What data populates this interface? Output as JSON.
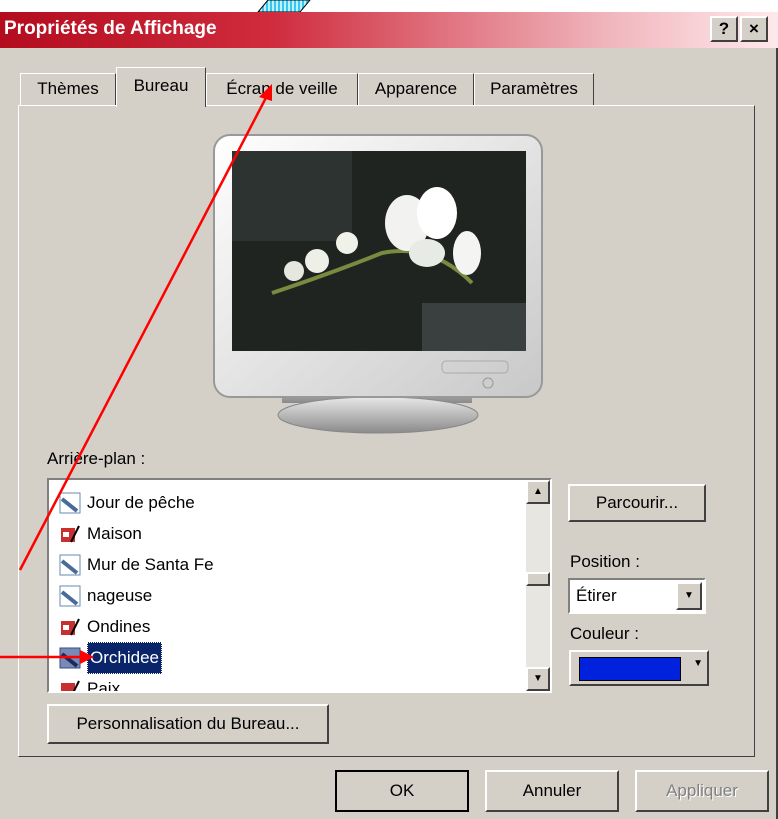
{
  "window": {
    "title": "Propriétés de Affichage",
    "help_label": "?",
    "close_label": "×"
  },
  "tabs": [
    {
      "label": "Thèmes"
    },
    {
      "label": "Bureau",
      "active": true
    },
    {
      "label": "Écran de veille"
    },
    {
      "label": "Apparence"
    },
    {
      "label": "Paramètres"
    }
  ],
  "background": {
    "label": "Arrière-plan :",
    "items": [
      {
        "label": "Jour de pêche",
        "icon": "image-file-icon"
      },
      {
        "label": "Maison",
        "icon": "bitmap-file-icon"
      },
      {
        "label": "Mur de Santa Fe",
        "icon": "image-file-icon"
      },
      {
        "label": "nageuse",
        "icon": "image-file-icon"
      },
      {
        "label": "Ondines",
        "icon": "bitmap-file-icon"
      },
      {
        "label": "Orchidee",
        "icon": "image-file-icon",
        "selected": true
      },
      {
        "label": "Paix",
        "icon": "bitmap-file-icon"
      }
    ]
  },
  "side": {
    "browse_label": "Parcourir...",
    "position_label": "Position :",
    "position_value": "Étirer",
    "color_label": "Couleur :",
    "color_value": "#0022dd"
  },
  "customize_label": "Personnalisation du Bureau...",
  "footer": {
    "ok_label": "OK",
    "cancel_label": "Annuler",
    "apply_label": "Appliquer"
  },
  "colors": {
    "title_start": "#b30c1e",
    "annotation_arrow": "#ff0000",
    "dialog_face": "#d4d0c8",
    "selection": "#0a246a"
  }
}
